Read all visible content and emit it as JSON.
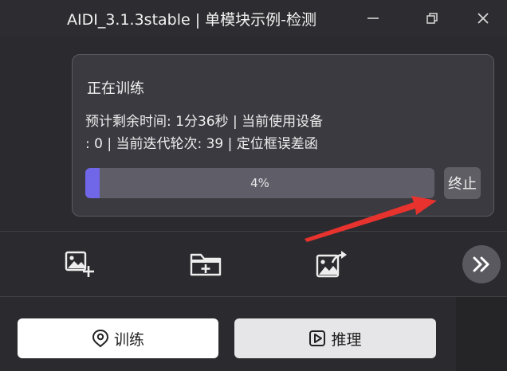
{
  "window": {
    "title": "AIDI_3.1.3stable | 单模块示例-检测"
  },
  "progress_panel": {
    "status": "正在训练",
    "info_line1": "预计剩余时间: 1分36秒 | 当前使用设备",
    "info_line2": ": 0 | 当前迭代轮次: 39 | 定位框误差函",
    "progress_percent": 4,
    "progress_label": "4%",
    "stop_label": "终止"
  },
  "toolbar": {
    "icons": [
      "add-image-icon",
      "add-folder-icon",
      "export-image-icon",
      "more-icon"
    ]
  },
  "actions": {
    "train_label": "训练",
    "infer_label": "推理"
  },
  "colors": {
    "accent": "#6f66e8",
    "annotation_arrow": "#e8322e"
  }
}
